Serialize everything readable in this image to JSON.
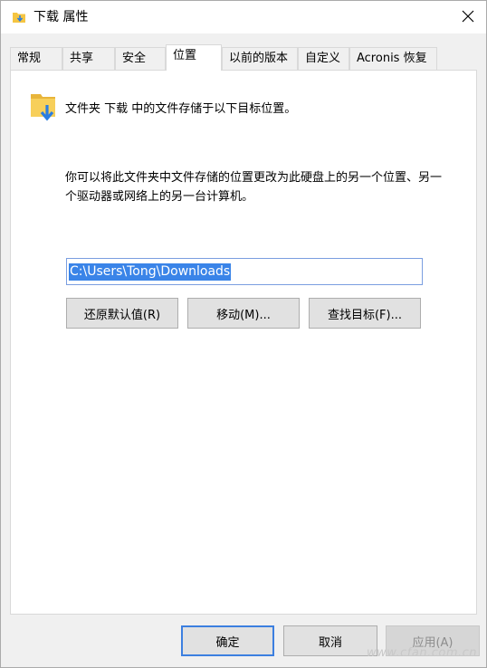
{
  "window": {
    "title": "下载 属性",
    "close_glyph": "✕"
  },
  "tabs": [
    {
      "label": "常规"
    },
    {
      "label": "共享"
    },
    {
      "label": "安全"
    },
    {
      "label": "位置",
      "active": true
    },
    {
      "label": "以前的版本"
    },
    {
      "label": "自定义"
    },
    {
      "label": "Acronis 恢复"
    }
  ],
  "location": {
    "folder_caption": "文件夹 下载 中的文件存储于以下目标位置。",
    "description": "你可以将此文件夹中文件存储的位置更改为此硬盘上的另一个位置、另一个驱动器或网络上的另一台计算机。",
    "path_value": "C:\\Users\\Tong\\Downloads",
    "restore_default_label": "还原默认值(R)",
    "move_label": "移动(M)...",
    "find_target_label": "查找目标(F)..."
  },
  "footer": {
    "ok_label": "确定",
    "cancel_label": "取消",
    "apply_label": "应用(A)"
  },
  "watermark": "www.cfan.com.cn",
  "colors": {
    "selection": "#3a84e8",
    "default_button_border": "#3c7fe0",
    "folder_yellow": "#f5c542",
    "arrow_blue": "#2a7de1"
  }
}
